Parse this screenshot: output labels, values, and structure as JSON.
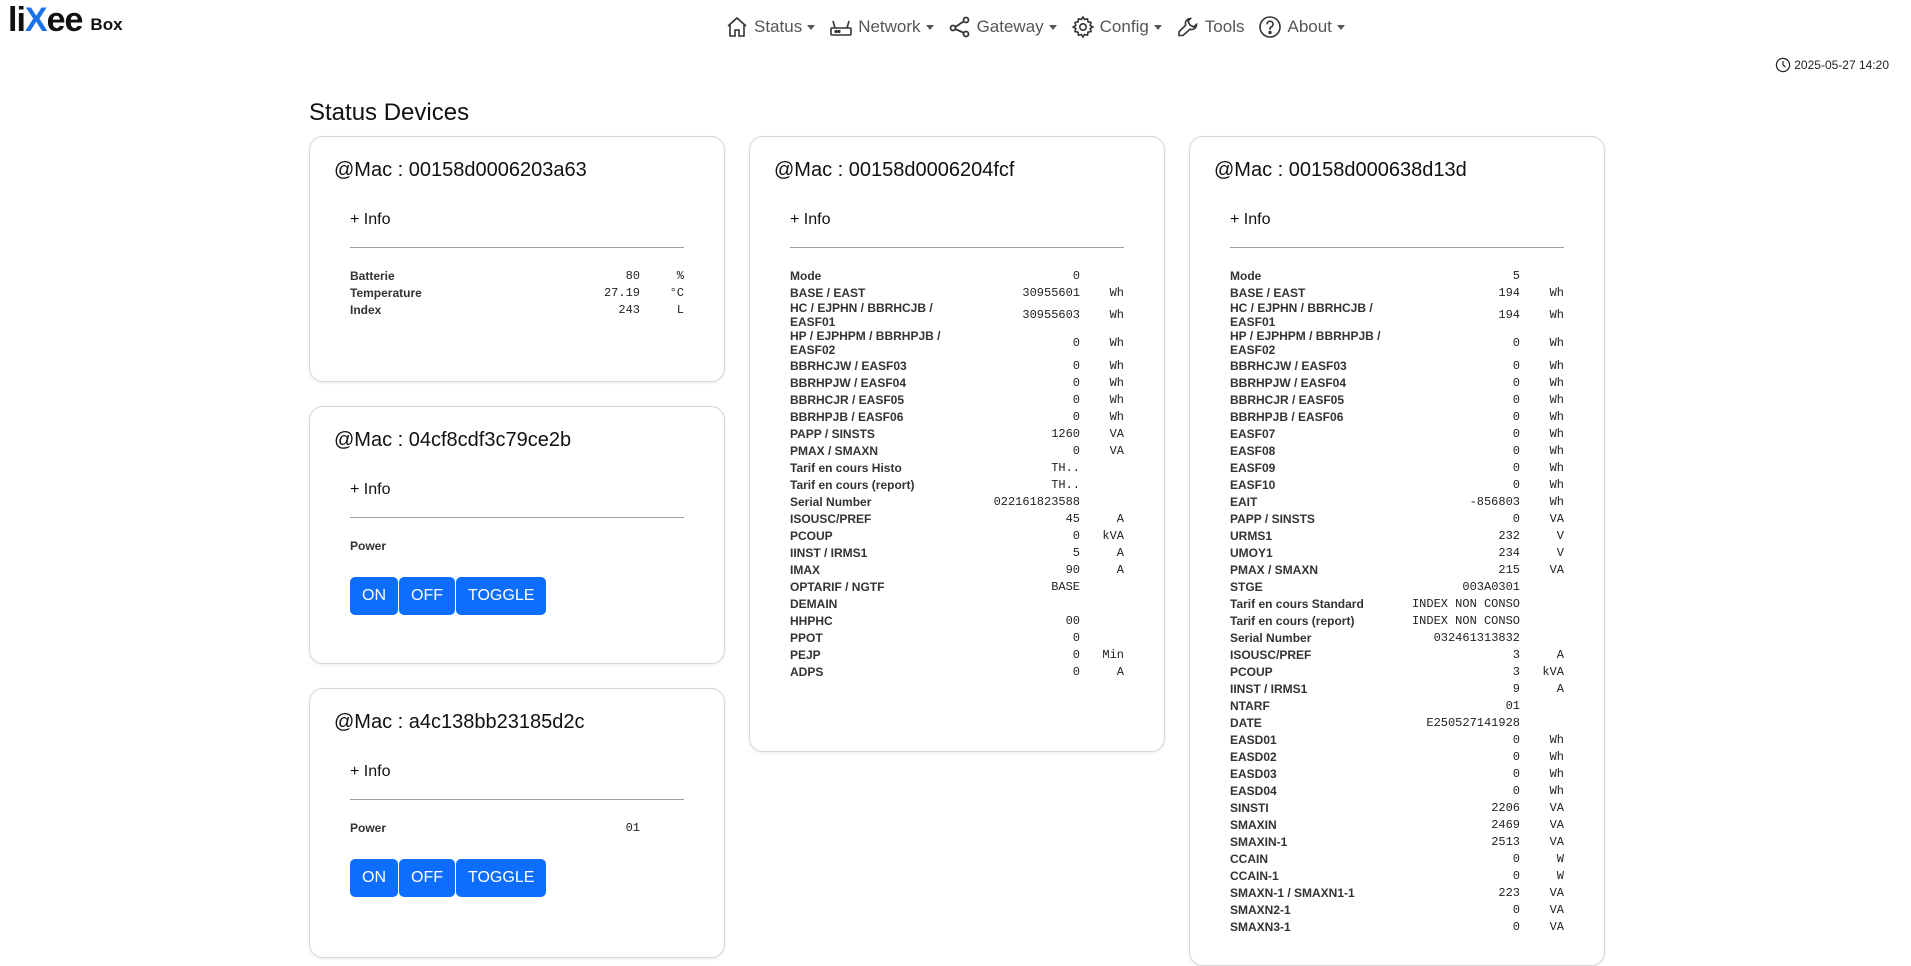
{
  "brand": {
    "logo": "liXee",
    "name": "Box"
  },
  "nav": [
    {
      "label": "Status",
      "icon": "house-icon"
    },
    {
      "label": "Network",
      "icon": "router-icon"
    },
    {
      "label": "Gateway",
      "icon": "share-icon"
    },
    {
      "label": "Config",
      "icon": "gear-icon"
    },
    {
      "label": "Tools",
      "icon": "wrench-icon"
    },
    {
      "label": "About",
      "icon": "question-circle-icon"
    }
  ],
  "datetime": "2025-05-27 14:20",
  "page_title": "Status Devices",
  "info_label": "+ Info",
  "cards": [
    {
      "mac": "@Mac : 00158d0006203a63",
      "rows": [
        {
          "label": "Batterie",
          "value": "80",
          "unit": "%"
        },
        {
          "label": "Temperature",
          "value": "27.19",
          "unit": "°C"
        },
        {
          "label": "Index",
          "value": "243",
          "unit": "L"
        }
      ]
    },
    {
      "mac": "@Mac : 04cf8cdf3c79ce2b",
      "rows": [
        {
          "label": "Power",
          "value": "",
          "unit": ""
        }
      ],
      "buttons": [
        "ON",
        "OFF",
        "TOGGLE"
      ]
    },
    {
      "mac": "@Mac : a4c138bb23185d2c",
      "rows": [
        {
          "label": "Power",
          "value": "01",
          "unit": ""
        }
      ],
      "buttons": [
        "ON",
        "OFF",
        "TOGGLE"
      ]
    },
    {
      "mac": "@Mac : 00158d0006204fcf",
      "rows": [
        {
          "label": "Mode",
          "value": "0",
          "unit": ""
        },
        {
          "label": "BASE / EAST",
          "value": "30955601",
          "unit": "Wh"
        },
        {
          "label": "HC / EJPHN / BBRHCJB / EASF01",
          "value": "30955603",
          "unit": "Wh"
        },
        {
          "label": "HP / EJPHPM / BBRHPJB / EASF02",
          "value": "0",
          "unit": "Wh"
        },
        {
          "label": "BBRHCJW / EASF03",
          "value": "0",
          "unit": "Wh"
        },
        {
          "label": "BBRHPJW / EASF04",
          "value": "0",
          "unit": "Wh"
        },
        {
          "label": "BBRHCJR / EASF05",
          "value": "0",
          "unit": "Wh"
        },
        {
          "label": "BBRHPJB / EASF06",
          "value": "0",
          "unit": "Wh"
        },
        {
          "label": "PAPP / SINSTS",
          "value": "1260",
          "unit": "VA"
        },
        {
          "label": "PMAX / SMAXN",
          "value": "0",
          "unit": "VA"
        },
        {
          "label": "Tarif en cours Histo",
          "value": "TH..",
          "unit": ""
        },
        {
          "label": "Tarif en cours (report)",
          "value": "TH..",
          "unit": ""
        },
        {
          "label": "Serial Number",
          "value": "022161823588",
          "unit": ""
        },
        {
          "label": "ISOUSC/PREF",
          "value": "45",
          "unit": "A"
        },
        {
          "label": "PCOUP",
          "value": "0",
          "unit": "kVA"
        },
        {
          "label": "IINST / IRMS1",
          "value": "5",
          "unit": "A"
        },
        {
          "label": "IMAX",
          "value": "90",
          "unit": "A"
        },
        {
          "label": "OPTARIF / NGTF",
          "value": "BASE",
          "unit": ""
        },
        {
          "label": "DEMAIN",
          "value": "",
          "unit": ""
        },
        {
          "label": "HHPHC",
          "value": "00",
          "unit": ""
        },
        {
          "label": "PPOT",
          "value": "0",
          "unit": ""
        },
        {
          "label": "PEJP",
          "value": "0",
          "unit": "Min"
        },
        {
          "label": "ADPS",
          "value": "0",
          "unit": "A"
        }
      ]
    },
    {
      "mac": "@Mac : 00158d000638d13d",
      "rows": [
        {
          "label": "Mode",
          "value": "5",
          "unit": ""
        },
        {
          "label": "BASE / EAST",
          "value": "194",
          "unit": "Wh"
        },
        {
          "label": "HC / EJPHN / BBRHCJB / EASF01",
          "value": "194",
          "unit": "Wh"
        },
        {
          "label": "HP / EJPHPM / BBRHPJB / EASF02",
          "value": "0",
          "unit": "Wh"
        },
        {
          "label": "BBRHCJW / EASF03",
          "value": "0",
          "unit": "Wh"
        },
        {
          "label": "BBRHPJW / EASF04",
          "value": "0",
          "unit": "Wh"
        },
        {
          "label": "BBRHCJR / EASF05",
          "value": "0",
          "unit": "Wh"
        },
        {
          "label": "BBRHPJB / EASF06",
          "value": "0",
          "unit": "Wh"
        },
        {
          "label": "EASF07",
          "value": "0",
          "unit": "Wh"
        },
        {
          "label": "EASF08",
          "value": "0",
          "unit": "Wh"
        },
        {
          "label": "EASF09",
          "value": "0",
          "unit": "Wh"
        },
        {
          "label": "EASF10",
          "value": "0",
          "unit": "Wh"
        },
        {
          "label": "EAIT",
          "value": "-856803",
          "unit": "Wh"
        },
        {
          "label": "PAPP / SINSTS",
          "value": "0",
          "unit": "VA"
        },
        {
          "label": "URMS1",
          "value": "232",
          "unit": "V"
        },
        {
          "label": "UMOY1",
          "value": "234",
          "unit": "V"
        },
        {
          "label": "PMAX / SMAXN",
          "value": "215",
          "unit": "VA"
        },
        {
          "label": "STGE",
          "value": "003A0301",
          "unit": ""
        },
        {
          "label": "Tarif en cours Standard",
          "value": "INDEX NON CONSO",
          "unit": ""
        },
        {
          "label": "Tarif en cours (report)",
          "value": "INDEX NON CONSO",
          "unit": ""
        },
        {
          "label": "Serial Number",
          "value": "032461313832",
          "unit": ""
        },
        {
          "label": "ISOUSC/PREF",
          "value": "3",
          "unit": "A"
        },
        {
          "label": "PCOUP",
          "value": "3",
          "unit": "kVA"
        },
        {
          "label": "IINST / IRMS1",
          "value": "9",
          "unit": "A"
        },
        {
          "label": "NTARF",
          "value": "01",
          "unit": ""
        },
        {
          "label": "DATE",
          "value": "E250527141928",
          "unit": ""
        },
        {
          "label": "EASD01",
          "value": "0",
          "unit": "Wh"
        },
        {
          "label": "EASD02",
          "value": "0",
          "unit": "Wh"
        },
        {
          "label": "EASD03",
          "value": "0",
          "unit": "Wh"
        },
        {
          "label": "EASD04",
          "value": "0",
          "unit": "Wh"
        },
        {
          "label": "SINSTI",
          "value": "2206",
          "unit": "VA"
        },
        {
          "label": "SMAXIN",
          "value": "2469",
          "unit": "VA"
        },
        {
          "label": "SMAXIN-1",
          "value": "2513",
          "unit": "VA"
        },
        {
          "label": "CCAIN",
          "value": "0",
          "unit": "W"
        },
        {
          "label": "CCAIN-1",
          "value": "0",
          "unit": "W"
        },
        {
          "label": "SMAXN-1 / SMAXN1-1",
          "value": "223",
          "unit": "VA"
        },
        {
          "label": "SMAXN2-1",
          "value": "0",
          "unit": "VA"
        },
        {
          "label": "SMAXN3-1",
          "value": "0",
          "unit": "VA"
        }
      ]
    }
  ]
}
